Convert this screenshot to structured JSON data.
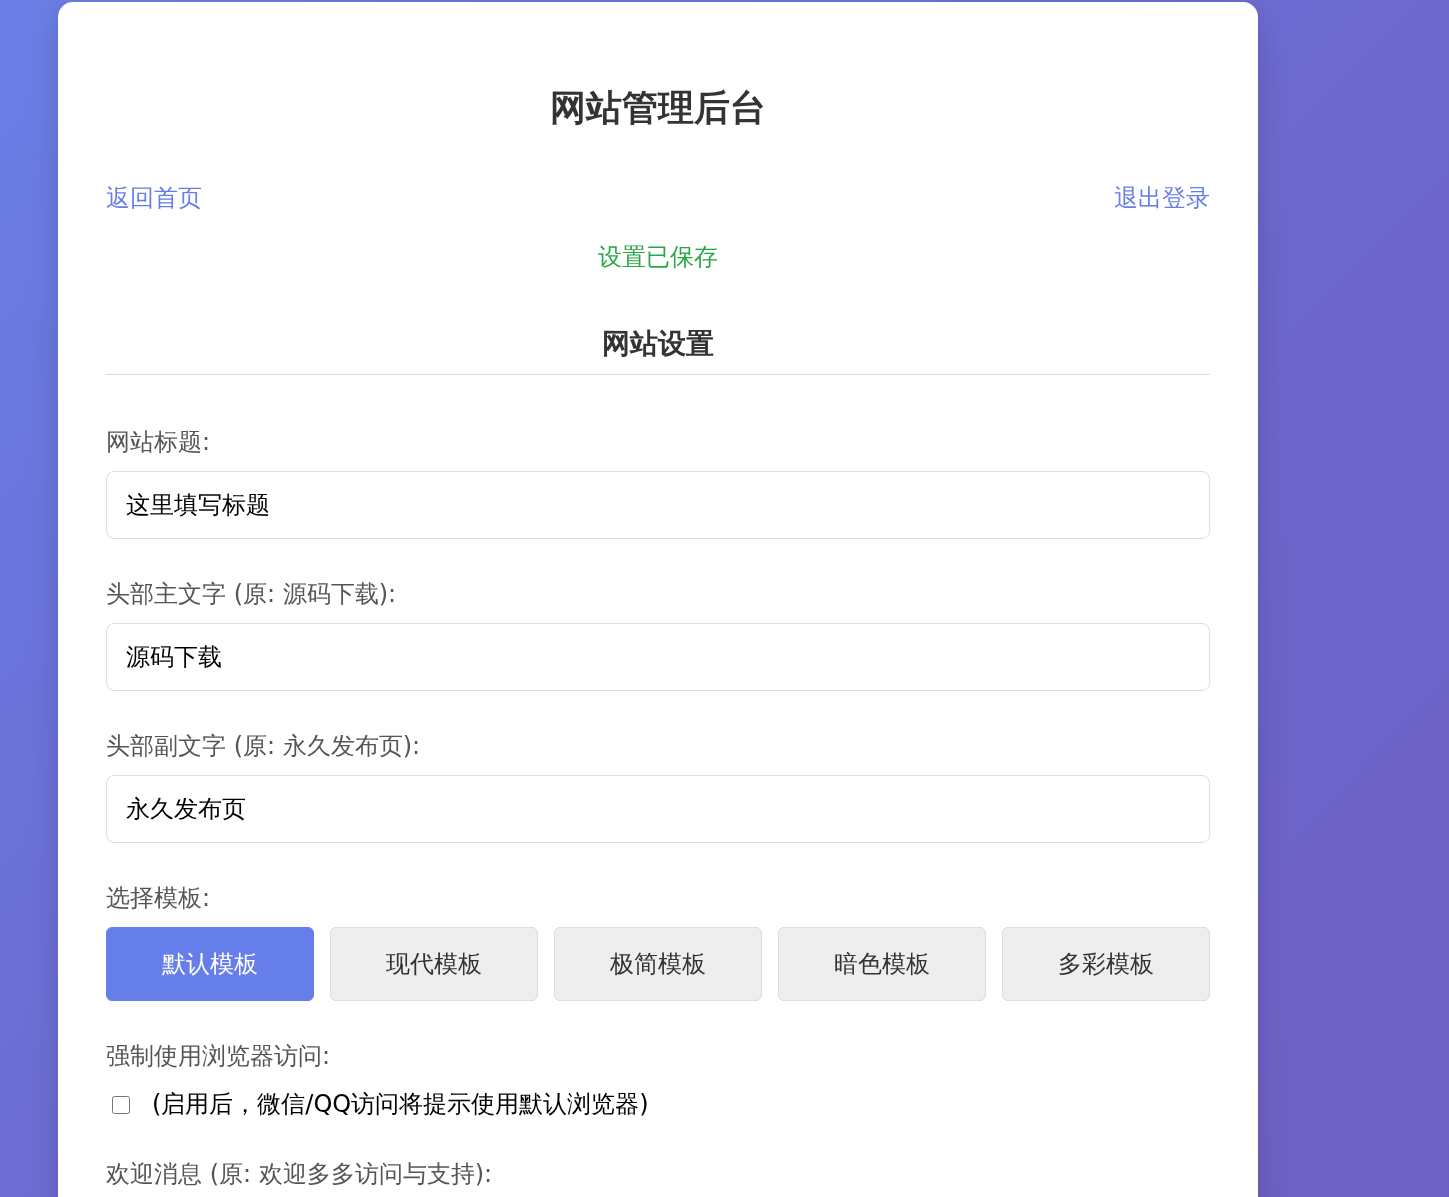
{
  "header": {
    "title": "网站管理后台"
  },
  "nav": {
    "links": [
      {
        "label": "返回首页"
      },
      {
        "label": "退出登录"
      }
    ]
  },
  "status_message": {
    "text": "设置已保存",
    "kind": "success"
  },
  "settings": {
    "title": "网站设置",
    "fields": [
      {
        "label": "网站标题:",
        "value": "这里填写标题"
      },
      {
        "label": "头部主文字 (原: 源码下载):",
        "value": "源码下载"
      },
      {
        "label": "头部副文字 (原: 永久发布页):",
        "value": "永久发布页"
      }
    ],
    "template": {
      "label": "选择模板:",
      "options": [
        {
          "label": "默认模板",
          "selected": true
        },
        {
          "label": "现代模板",
          "selected": false
        },
        {
          "label": "极简模板",
          "selected": false
        },
        {
          "label": "暗色模板",
          "selected": false
        },
        {
          "label": "多彩模板",
          "selected": false
        }
      ]
    },
    "force_browser": {
      "label": "强制使用浏览器访问:",
      "checked": false,
      "hint": "(启用后，微信/QQ访问将提示使用默认浏览器)"
    },
    "welcome": {
      "label": "欢迎消息 (原: 欢迎多多访问与支持):"
    }
  }
}
